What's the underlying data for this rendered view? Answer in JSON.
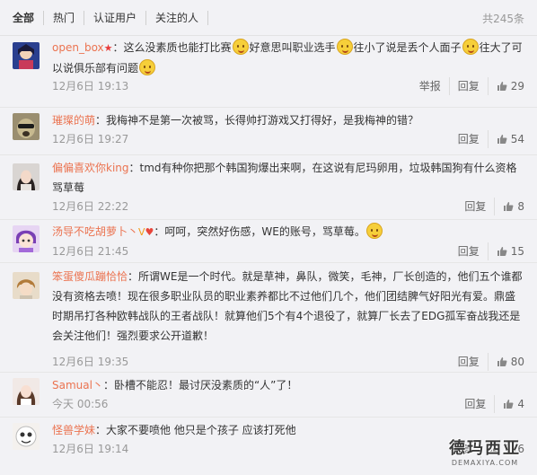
{
  "tabs": [
    "全部",
    "热门",
    "认证用户",
    "关注的人"
  ],
  "total": "共245条",
  "comments": [
    {
      "user": "open_box",
      "parts": [
        "：这么没素质也能打比赛",
        "好意思叫职业选手",
        "往小了说是丢个人面子",
        "往大了可以说俱乐部有问题"
      ],
      "time": "12月6日 19:13",
      "report": "举报",
      "reply": "回复",
      "likes": "29"
    },
    {
      "user": "璀璨的萌",
      "parts": [
        "：我梅神不是第一次被骂，长得帅打游戏又打得好，是我梅神的错？"
      ],
      "time": "12月6日 19:27",
      "reply": "回复",
      "likes": "54"
    },
    {
      "user": "偏偏喜欢你king",
      "parts": [
        "：tmd有种你把那个韩国狗爆出来啊，在这说有尼玛卵用，垃圾韩国狗有什么资格骂草莓"
      ],
      "time": "12月6日 22:22",
      "reply": "回复",
      "likes": "8"
    },
    {
      "user": "汤导不吃胡萝卜丶",
      "parts": [
        "：呵呵，突然好伤感，WE的账号，骂草莓。"
      ],
      "time": "12月6日 21:45",
      "reply": "回复",
      "likes": "15"
    },
    {
      "user": "笨蛋傻瓜蹦恰恰",
      "parts": [
        "：所谓WE是一个时代。就是草神，鼻队，微笑，毛神，厂长创造的，他们五个谁都没有资格去喷！现在很多职业队员的职业素养都比不过他们几个，他们团结脾气好阳光有爱。鼎盛时期吊打各种欧韩战队的王者战队！就算他们5个有4个退役了，就算厂长去了EDG孤军奋战我还是会关注他们！强烈要求公开道歉！"
      ],
      "time": "12月6日 19:35",
      "reply": "回复",
      "likes": "80"
    },
    {
      "user": "Samual丶",
      "parts": [
        "：卧槽不能忍！最讨厌没素质的“人”了！"
      ],
      "time": "今天 00:56",
      "reply": "回复",
      "likes": "4"
    },
    {
      "user": "怪兽学妹",
      "parts": [
        "：大家不要喷他 他只是个孩子 应该打死他"
      ],
      "time": "12月6日 19:14",
      "reply": "回复",
      "likes": "106"
    }
  ],
  "watermark": {
    "title": "德玛西亚",
    "sub": "DEMAXIYA.COM"
  },
  "colors": {
    "username": "#eb7350",
    "background": "#f2f2f5"
  }
}
